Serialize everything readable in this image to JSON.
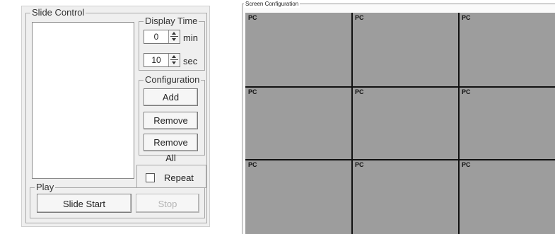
{
  "slide_control": {
    "title": "Slide Control",
    "display_time": {
      "title": "Display Time",
      "minutes_value": "0",
      "minutes_unit": "min",
      "seconds_value": "10",
      "seconds_unit": "sec"
    },
    "configuration": {
      "title": "Configuration",
      "add_label": "Add",
      "remove_label": "Remove",
      "remove_all_label": "Remove All"
    },
    "repeat_label": "Repeat",
    "repeat_checked": false,
    "play": {
      "title": "Play",
      "start_label": "Slide Start",
      "stop_label": "Stop"
    }
  },
  "screen_configuration": {
    "title": "Screen Configuration",
    "rows": 3,
    "columns": 3,
    "cells": [
      "PC",
      "PC",
      "PC",
      "PC",
      "PC",
      "PC",
      "PC",
      "PC",
      "PC"
    ]
  }
}
